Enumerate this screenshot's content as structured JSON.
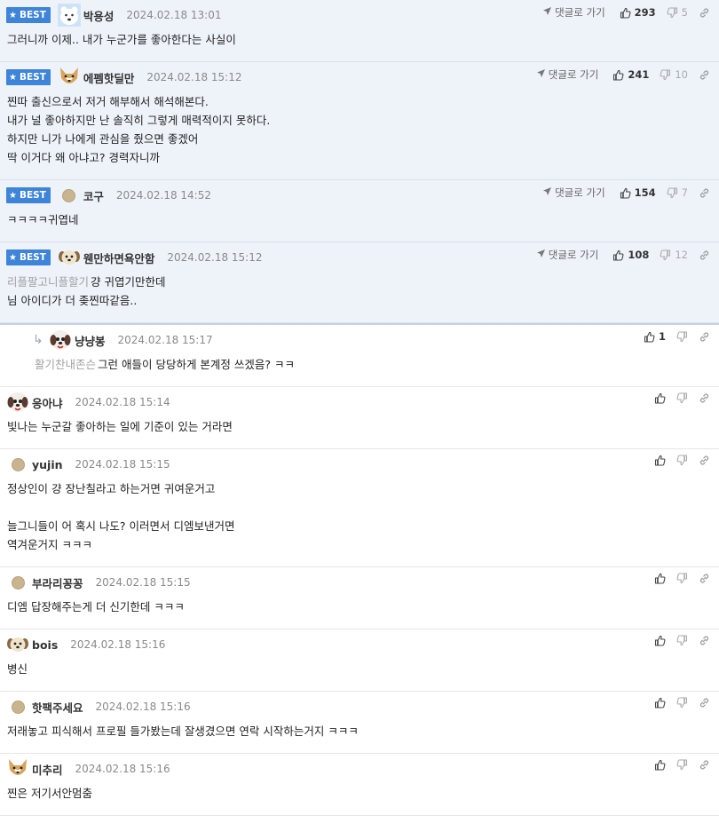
{
  "labels": {
    "best": "BEST",
    "goto": "댓글로 가기"
  },
  "colors": {
    "best_bg": "#eef3fa",
    "badge": "#3e84d8"
  },
  "comments": [
    {
      "best": true,
      "avatar": "polar-bear-icon",
      "nick": "박용성",
      "date": "2024.02.18 13:01",
      "likes": "293",
      "dislikes": "5",
      "lines": [
        "그러니까 이제.. 내가 누군가를 좋아한다는 사실이"
      ]
    },
    {
      "best": true,
      "avatar": "fox-dog-icon",
      "nick": "에펨핫딜만",
      "date": "2024.02.18 15:12",
      "likes": "241",
      "dislikes": "10",
      "lines": [
        "찐따 출신으로서 저거 해부해서 해석해본다.",
        "내가 널 좋아하지만 난 솔직히 그렇게 매력적이지 못하다.",
        "하지만 니가 나에게 관심을 줬으면 좋겠어",
        "딱 이거다 왜 아냐고? 경력자니까"
      ]
    },
    {
      "best": true,
      "avatar": "default-dot-icon",
      "nick": "코구",
      "date": "2024.02.18 14:52",
      "likes": "154",
      "dislikes": "7",
      "lines": [
        "ㅋㅋㅋㅋ귀엽네"
      ]
    },
    {
      "best": true,
      "avatar": "puppy-icon",
      "nick": "웬만하면욕안함",
      "date": "2024.02.18 15:12",
      "likes": "108",
      "dislikes": "12",
      "quote": "리플팔고니플할기",
      "lines": [
        "걍 귀엽기만한데",
        "님 아이디가 더 좆찐따같음.."
      ]
    },
    {
      "reply": true,
      "avatar": "dog-face-icon",
      "nick": "냥냥봉",
      "date": "2024.02.18 15:17",
      "likes": "1",
      "quote": "활기찬내존슨",
      "lines": [
        "그런 애들이 당당하게 본계정 쓰겠음? ㅋㅋ"
      ]
    },
    {
      "avatar": "dog-face-icon",
      "nick": "응아냐",
      "date": "2024.02.18 15:14",
      "lines": [
        "빛나는 누군갈 좋아하는 일에 기준이 있는 거라면"
      ]
    },
    {
      "avatar": "default-dot-icon",
      "nick": "yujin",
      "date": "2024.02.18 15:15",
      "lines": [
        "정상인이 걍 장난칠라고 하는거면 귀여운거고",
        "",
        "늘그니들이 어 혹시 나도? 이러면서 디엠보낸거면",
        "역겨운거지 ㅋㅋㅋ"
      ]
    },
    {
      "avatar": "default-dot-icon",
      "nick": "부라리꽁꽁",
      "date": "2024.02.18 15:15",
      "lines": [
        "디엠 답장해주는게 더 신기한데 ㅋㅋㅋ"
      ]
    },
    {
      "avatar": "puppy-icon",
      "nick": "bois",
      "date": "2024.02.18 15:16",
      "lines": [
        "병신"
      ]
    },
    {
      "avatar": "default-dot-icon",
      "nick": "핫팩주세요",
      "date": "2024.02.18 15:16",
      "lines": [
        "저래놓고 피식해서 프로필 들가봤는데 잘생겼으면 연락 시작하는거지 ㅋㅋㅋ"
      ]
    },
    {
      "avatar": "fox-dog-icon",
      "nick": "미추리",
      "date": "2024.02.18 15:16",
      "lines": [
        "찐은 저기서안멈춤"
      ]
    }
  ]
}
